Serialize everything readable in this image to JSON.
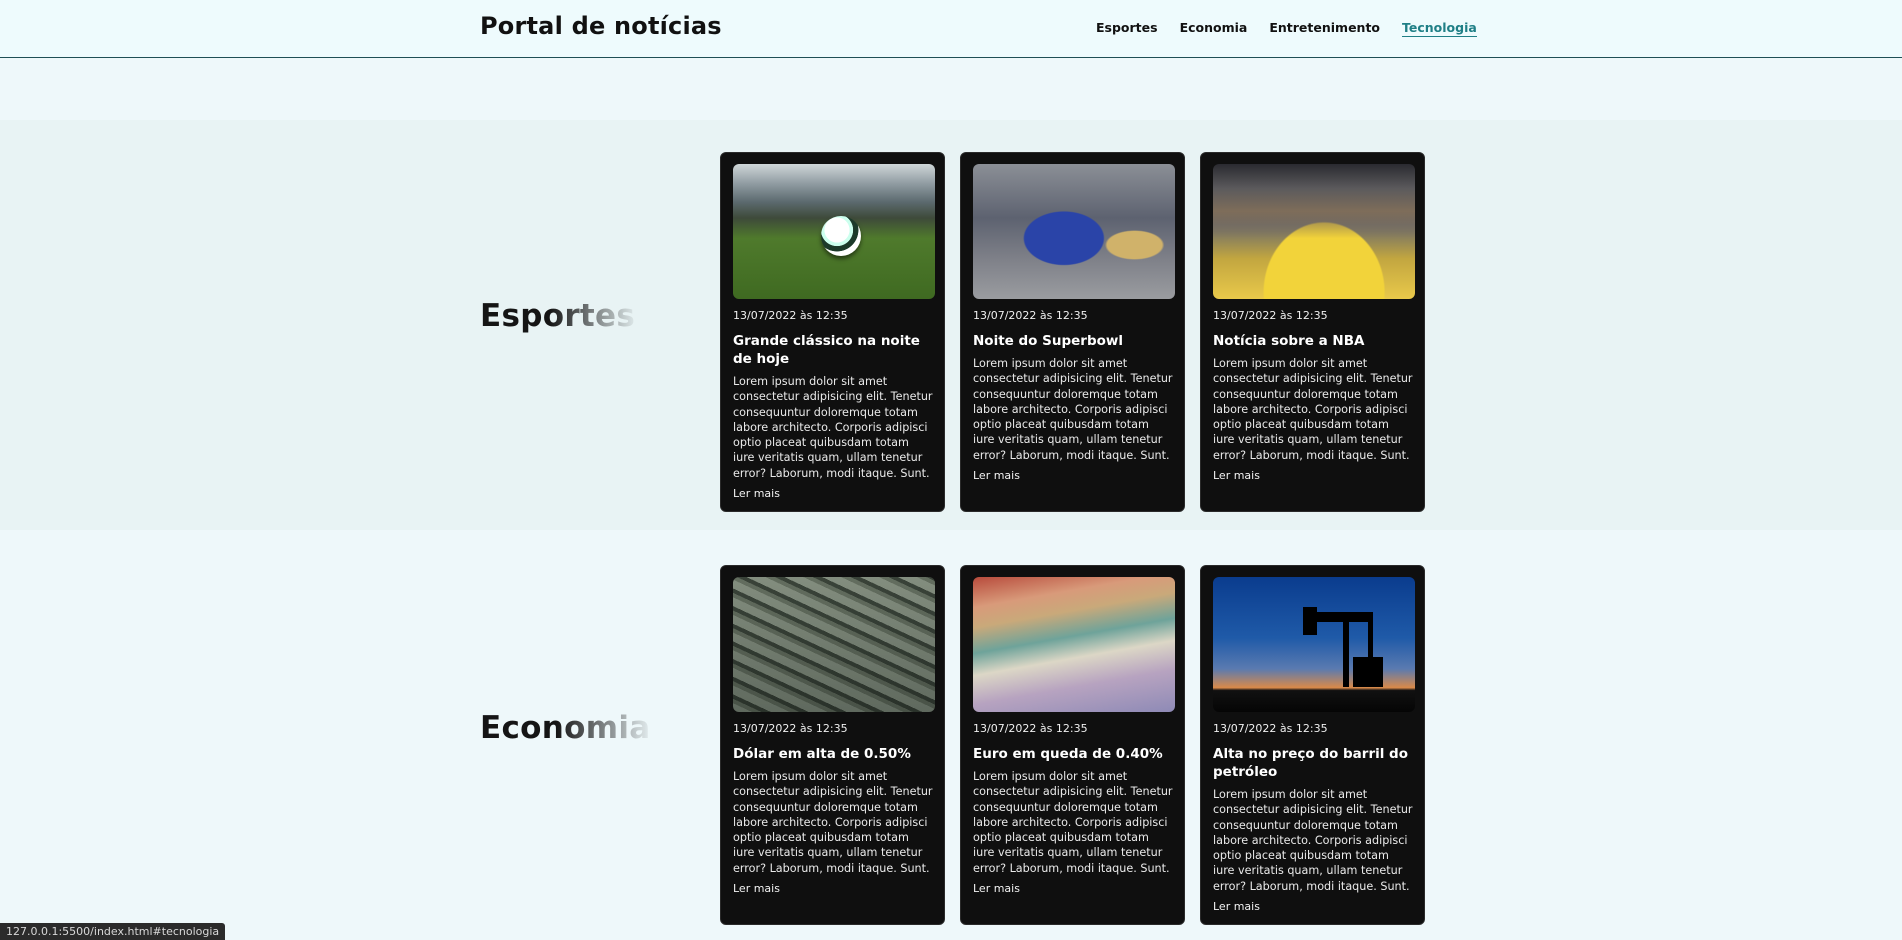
{
  "header": {
    "brand": "Portal de notícias",
    "nav": [
      "Esportes",
      "Economia",
      "Entretenimento",
      "Tecnologia"
    ],
    "active_nav": "Tecnologia"
  },
  "sections": [
    {
      "title": "Esportes",
      "cards": [
        {
          "image": "soccer-ball-stadium",
          "date": "13/07/2022 às 12:35",
          "title": "Grande clássico na noite de hoje",
          "text": "Lorem ipsum dolor sit amet consectetur adipisicing elit. Tenetur consequuntur doloremque totam labore architecto. Corporis adipisci optio placeat quibusdam totam iure veritatis quam, ullam tenetur error? Laborum, modi itaque. Sunt.",
          "more": "Ler mais"
        },
        {
          "image": "american-football-player",
          "date": "13/07/2022 às 12:35",
          "title": "Noite do Superbowl",
          "text": "Lorem ipsum dolor sit amet consectetur adipisicing elit. Tenetur consequuntur doloremque totam labore architecto. Corporis adipisci optio placeat quibusdam totam iure veritatis quam, ullam tenetur error? Laborum, modi itaque. Sunt.",
          "more": "Ler mais"
        },
        {
          "image": "basketball-arena",
          "date": "13/07/2022 às 12:35",
          "title": "Notícia sobre a NBA",
          "text": "Lorem ipsum dolor sit amet consectetur adipisicing elit. Tenetur consequuntur doloremque totam labore architecto. Corporis adipisci optio placeat quibusdam totam iure veritatis quam, ullam tenetur error? Laborum, modi itaque. Sunt.",
          "more": "Ler mais"
        }
      ]
    },
    {
      "title": "Economia",
      "cards": [
        {
          "image": "dollar-bills",
          "date": "13/07/2022 às 12:35",
          "title": "Dólar em alta de 0.50%",
          "text": "Lorem ipsum dolor sit amet consectetur adipisicing elit. Tenetur consequuntur doloremque totam labore architecto. Corporis adipisci optio placeat quibusdam totam iure veritatis quam, ullam tenetur error? Laborum, modi itaque. Sunt.",
          "more": "Ler mais"
        },
        {
          "image": "euro-banknotes",
          "date": "13/07/2022 às 12:35",
          "title": "Euro em queda de 0.40%",
          "text": "Lorem ipsum dolor sit amet consectetur adipisicing elit. Tenetur consequuntur doloremque totam labore architecto. Corporis adipisci optio placeat quibusdam totam iure veritatis quam, ullam tenetur error? Laborum, modi itaque. Sunt.",
          "more": "Ler mais"
        },
        {
          "image": "oil-pump-sunset",
          "date": "13/07/2022 às 12:35",
          "title": "Alta no preço do barril do petróleo",
          "text": "Lorem ipsum dolor sit amet consectetur adipisicing elit. Tenetur consequuntur doloremque totam labore architecto. Corporis adipisci optio placeat quibusdam totam iure veritatis quam, ullam tenetur error? Laborum, modi itaque. Sunt.",
          "more": "Ler mais"
        }
      ]
    }
  ],
  "statusbar": {
    "url": "127.0.0.1:5500/index.html#tecnologia"
  },
  "colors": {
    "card_bg": "#0f0f0f",
    "accent": "#1f7f86",
    "page_bg": "#eef8fa"
  }
}
